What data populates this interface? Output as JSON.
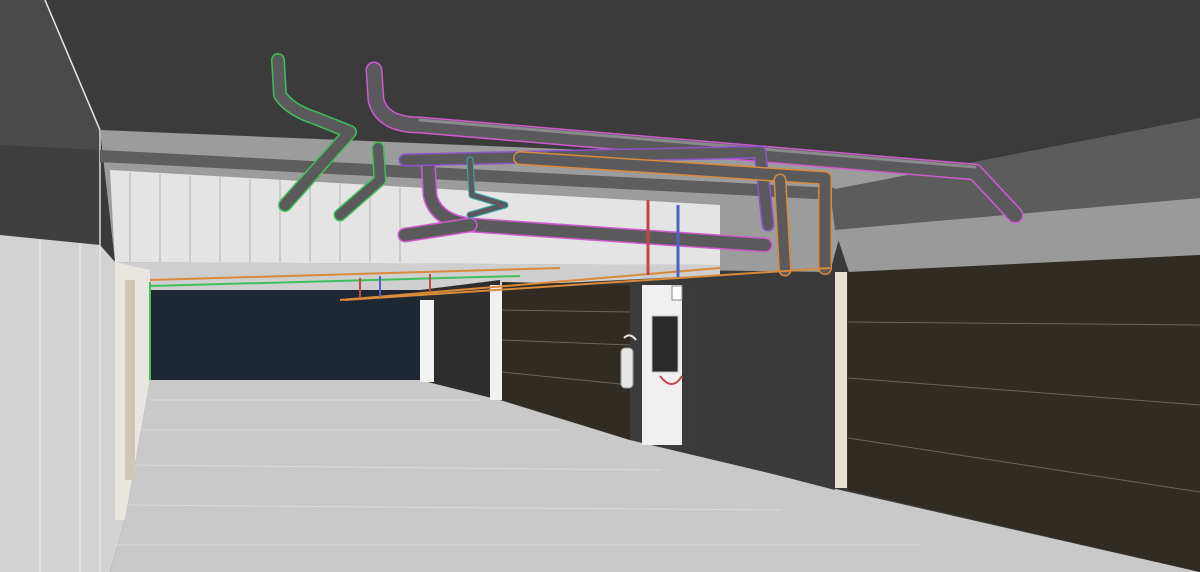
{
  "scene": {
    "colors": {
      "ceiling": "#3b3b3b",
      "floor": "#c9c9c9",
      "left_wall": "#d2d2d2",
      "garage_door": "#302c24",
      "far_opening": "#1f2732",
      "frame_white": "#f2f2f2"
    },
    "pipe_colors": {
      "green": "#3fbf5c",
      "magenta": "#d05ad0",
      "purple": "#8a55c8",
      "orange": "#d98a3a",
      "red": "#c04848",
      "blue": "#5060c8",
      "teal": "#3aa8a8"
    }
  }
}
